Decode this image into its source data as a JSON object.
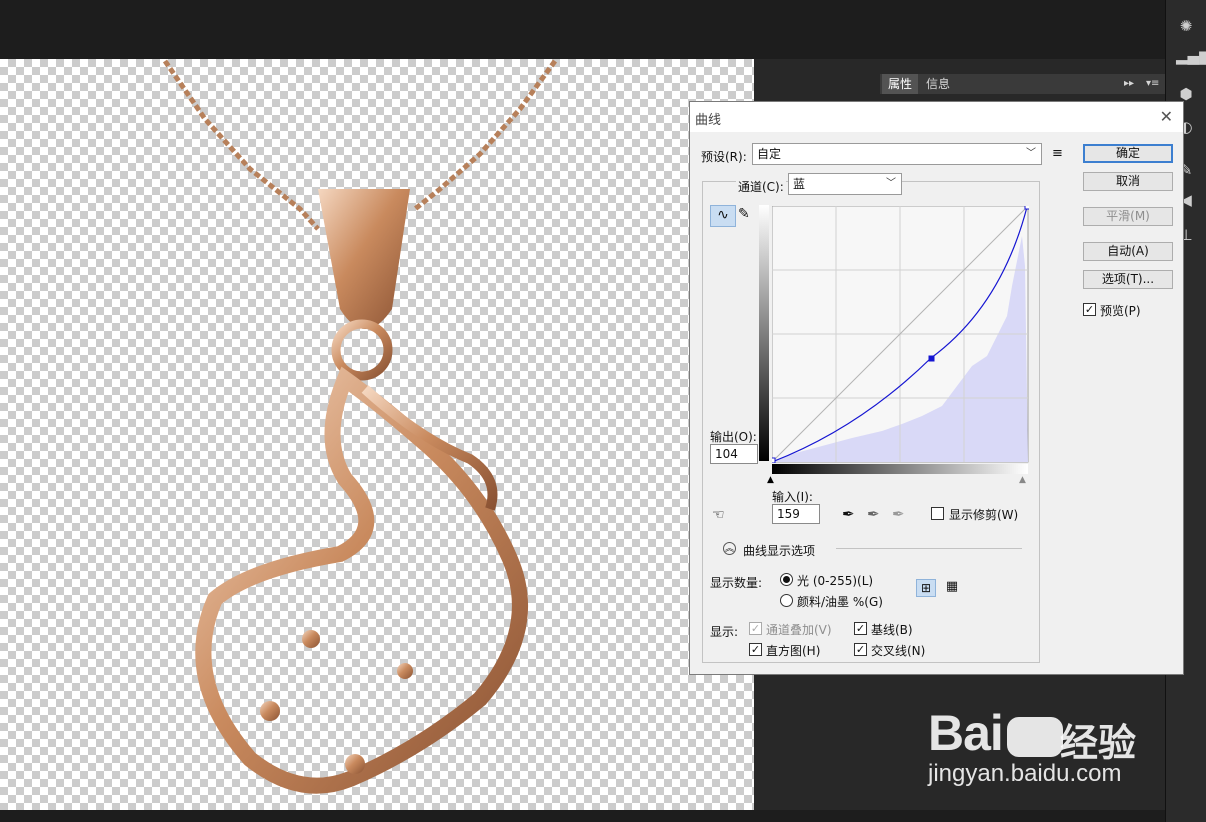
{
  "panel": {
    "tab_properties": "属性",
    "tab_info": "信息"
  },
  "dialog": {
    "title": "曲线",
    "preset_label": "预设(R):",
    "preset_value": "自定",
    "channel_label": "通道(C):",
    "channel_value": "蓝",
    "output_label": "输出(O):",
    "output_value": "104",
    "input_label": "输入(I):",
    "input_value": "159",
    "show_clipping": "显示修剪(W)",
    "curve_display_options": "曲线显示选项",
    "show_amount_label": "显示数量:",
    "light_option": "光 (0-255)(L)",
    "pigment_option": "颜料/油墨 %(G)",
    "show_label": "显示:",
    "channel_overlay": "通道叠加(V)",
    "baseline": "基线(B)",
    "histogram": "直方图(H)",
    "intersection": "交叉线(N)",
    "buttons": {
      "ok": "确定",
      "cancel": "取消",
      "smooth": "平滑(M)",
      "auto": "自动(A)",
      "options": "选项(T)..."
    },
    "preview": "预览(P)",
    "curve_points": [
      [
        0,
        0
      ],
      [
        159,
        104
      ],
      [
        255,
        255
      ]
    ]
  },
  "watermark": {
    "brand": "Bai",
    "brand_cn": "经验",
    "url": "jingyan.baidu.com"
  }
}
